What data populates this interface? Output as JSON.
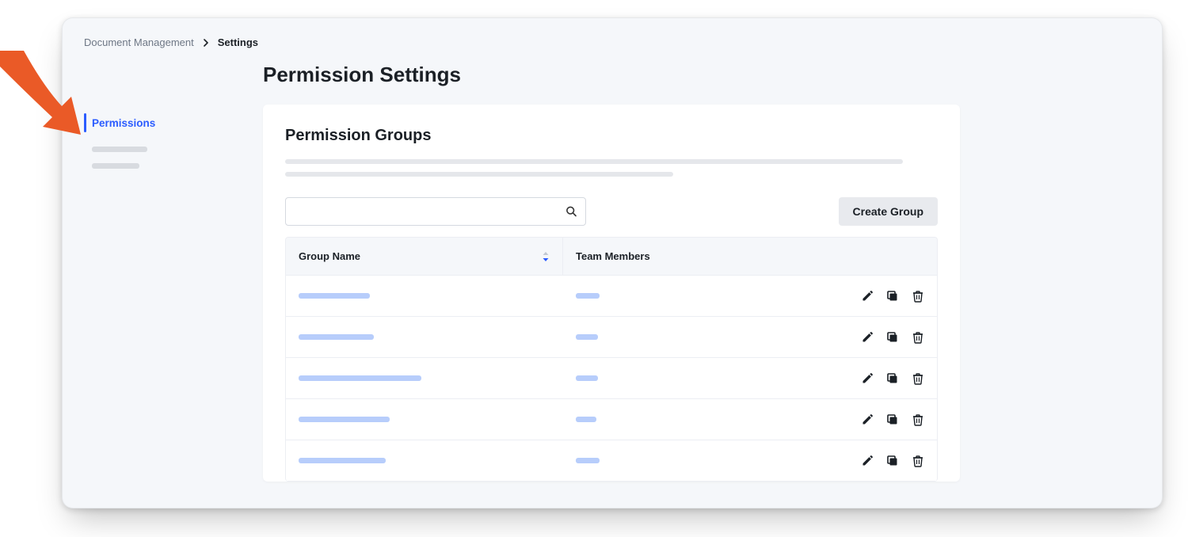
{
  "breadcrumb": {
    "root": "Document Management",
    "current": "Settings"
  },
  "sidebar": {
    "active_label": "Permissions",
    "placeholder_widths": [
      70,
      60
    ]
  },
  "page": {
    "title": "Permission Settings",
    "section_title": "Permission Groups",
    "desc_placeholder_widths": [
      780,
      490
    ]
  },
  "search": {
    "value": ""
  },
  "buttons": {
    "create": "Create Group"
  },
  "table": {
    "columns": {
      "name": "Group Name",
      "members": "Team Members"
    },
    "rows": [
      {
        "name_width": 90,
        "members_width": 30
      },
      {
        "name_width": 95,
        "members_width": 28
      },
      {
        "name_width": 155,
        "members_width": 28
      },
      {
        "name_width": 115,
        "members_width": 26
      },
      {
        "name_width": 110,
        "members_width": 30
      }
    ]
  },
  "icons": {
    "edit": "edit-icon",
    "copy": "copy-icon",
    "delete": "trash-icon",
    "search": "search-icon",
    "chevron": "chevron-right-icon",
    "sort": "sort-icon"
  },
  "colors": {
    "accent": "#2b5cff",
    "annotation_arrow": "#ea5a27",
    "row_bar": "#b7cdfb"
  }
}
